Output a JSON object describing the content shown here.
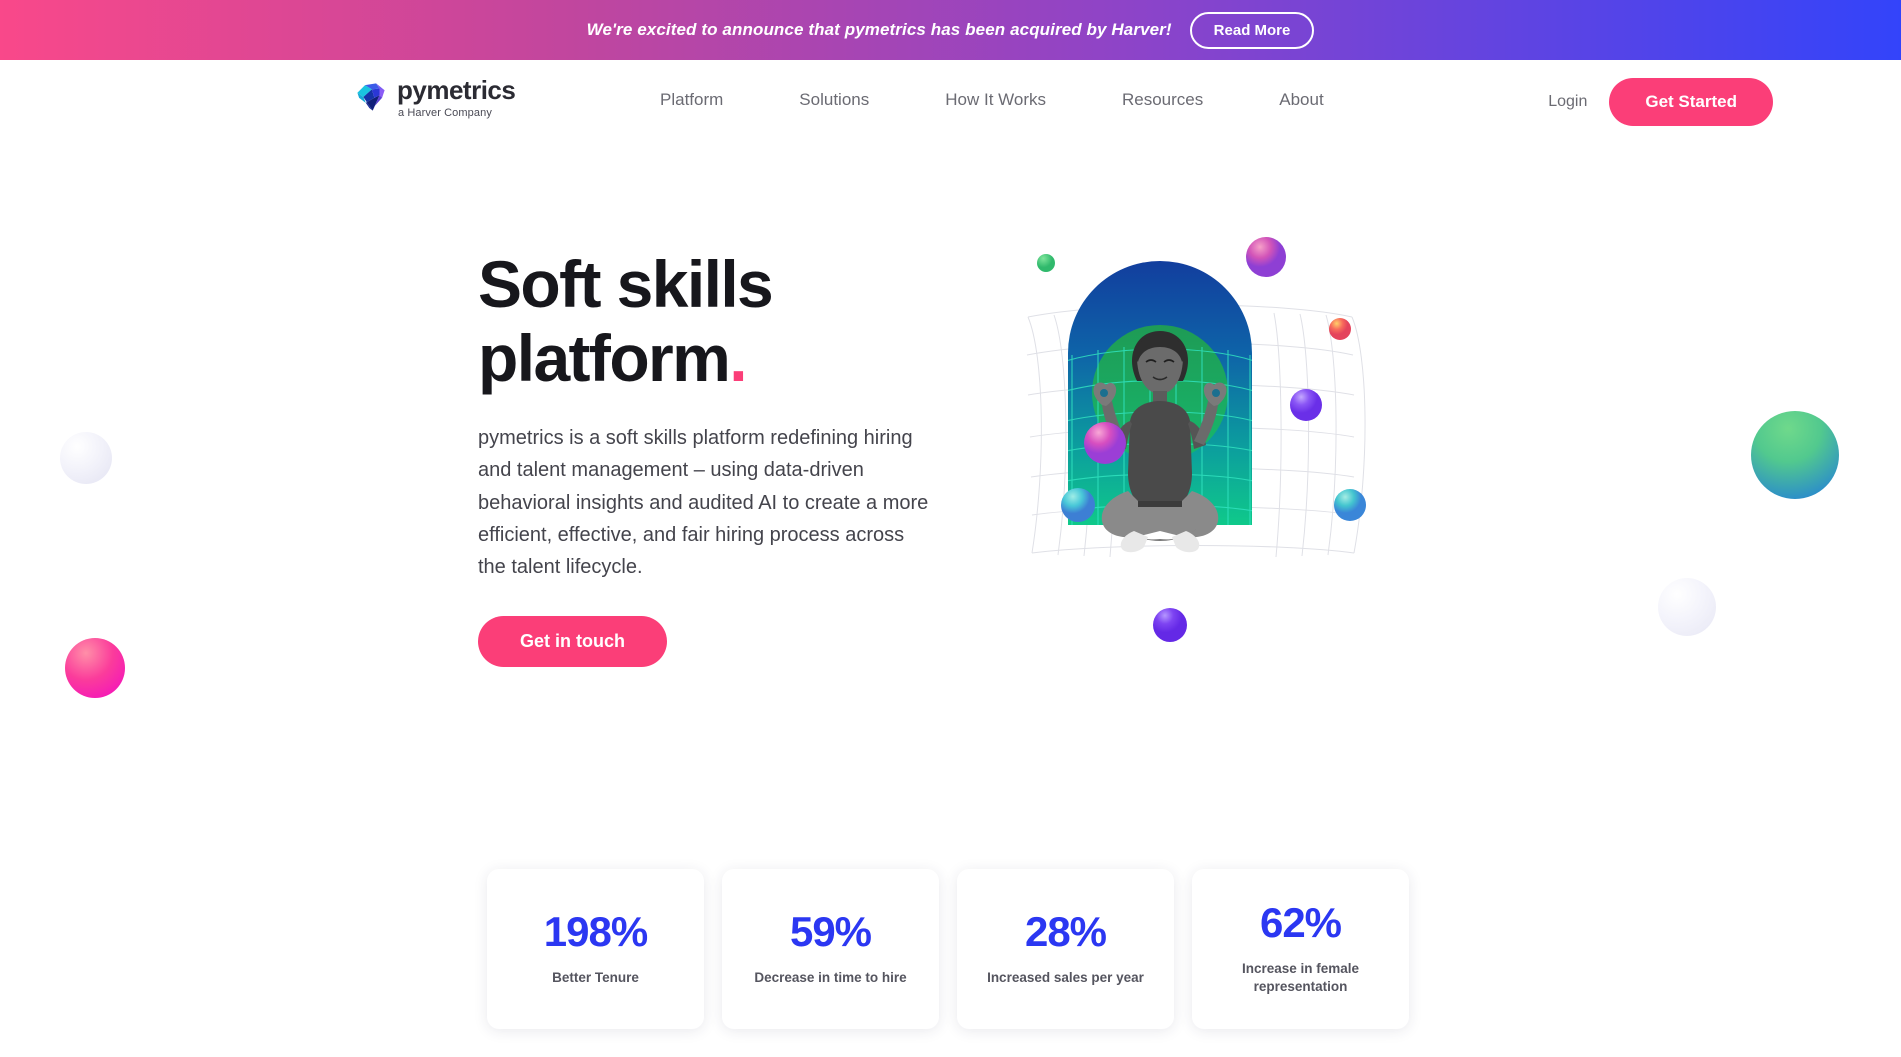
{
  "banner": {
    "message": "We're excited to announce that pymetrics has been acquired by Harver!",
    "button_label": "Read More",
    "gradient_start": "#F9488A",
    "gradient_end": "#3344FA"
  },
  "header": {
    "logo": {
      "icon": "gem-icon",
      "wordmark": "pymetrics",
      "tagline": "a Harver Company"
    },
    "nav_items": [
      {
        "label": "Platform"
      },
      {
        "label": "Solutions"
      },
      {
        "label": "How It Works"
      },
      {
        "label": "Resources"
      },
      {
        "label": "About"
      }
    ],
    "login_label": "Login",
    "cta_label": "Get Started",
    "cta_color": "#FB3E78"
  },
  "hero": {
    "title_line1": "Soft skills",
    "title_line2": "platform",
    "title_dot": ".",
    "paragraph": "pymetrics is a soft skills platform redefining hiring and talent management – using data-driven behavioral insights and audited AI to create a more efficient, effective, and fair hiring process across the talent lifecycle.",
    "button_label": "Get in touch",
    "illustration": "meditating-woman-illustration"
  },
  "stats": [
    {
      "value": "198%",
      "label": "Better Tenure"
    },
    {
      "value": "59%",
      "label": "Decrease in time to hire"
    },
    {
      "value": "28%",
      "label": "Increased sales per year"
    },
    {
      "value": "62%",
      "label": "Increase in female representation"
    }
  ],
  "accent_colors": {
    "pink": "#FB3E78",
    "blue": "#2B37F2",
    "banner_pink": "#F9488A",
    "banner_blue": "#3344FA"
  }
}
